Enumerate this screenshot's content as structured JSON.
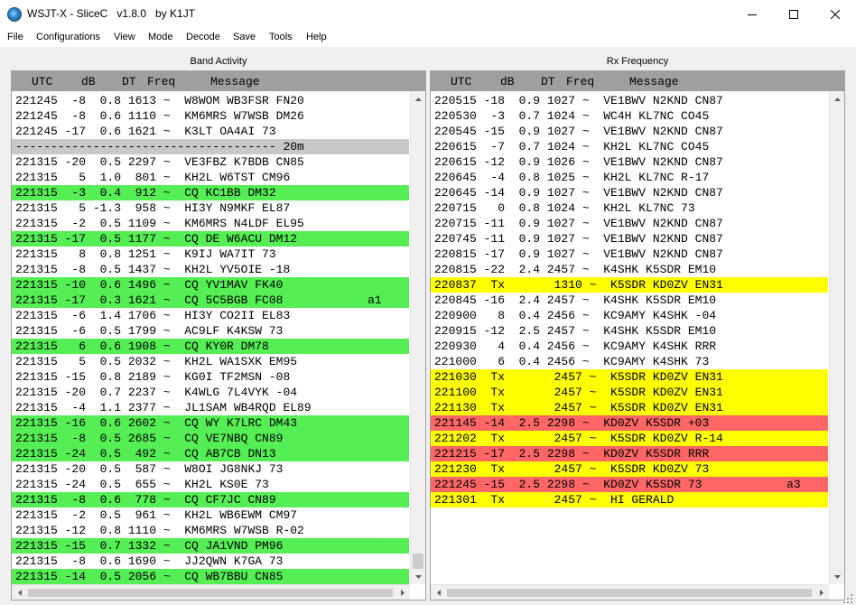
{
  "window": {
    "title": "WSJT-X - SliceC   v1.8.0   by K1JT"
  },
  "menu": [
    "File",
    "Configurations",
    "View",
    "Mode",
    "Decode",
    "Save",
    "Tools",
    "Help"
  ],
  "band_activity": {
    "title": "Band Activity",
    "columns": [
      "UTC",
      "dB",
      "DT",
      "Freq",
      "Message"
    ],
    "rows": [
      {
        "text": "221245  -8  0.8 1613 ~  W8WOM WB3FSR FN20",
        "hl": "none"
      },
      {
        "text": "221245  -8  0.6 1110 ~  KM6MRS W7WSB DM26",
        "hl": "none"
      },
      {
        "text": "221245 -17  0.6 1621 ~  K3LT OA4AI 73",
        "hl": "none"
      },
      {
        "text": "------------------------------------- 20m",
        "hl": "separator"
      },
      {
        "text": "221315 -20  0.5 2297 ~  VE3FBZ K7BDB CN85",
        "hl": "none"
      },
      {
        "text": "221315   5  1.0  801 ~  KH2L W6TST CM96",
        "hl": "none"
      },
      {
        "text": "221315  -3  0.4  912 ~  CQ KC1BB DM32",
        "hl": "cq"
      },
      {
        "text": "221315   5 -1.3  958 ~  HI3Y N9MKF EL87",
        "hl": "none"
      },
      {
        "text": "221315  -2  0.5 1109 ~  KM6MRS N4LDF EL95",
        "hl": "none"
      },
      {
        "text": "221315 -17  0.5 1177 ~  CQ DE W6ACU DM12",
        "hl": "cq"
      },
      {
        "text": "221315   8  0.8 1251 ~  K9IJ WA7IT 73",
        "hl": "none"
      },
      {
        "text": "221315  -8  0.5 1437 ~  KH2L YV5OIE -18",
        "hl": "none"
      },
      {
        "text": "221315 -10  0.6 1496 ~  CQ YV1MAV FK40",
        "hl": "cq"
      },
      {
        "text": "221315 -17  0.3 1621 ~  CQ 5C5BGB FC08            a1",
        "hl": "cq"
      },
      {
        "text": "221315  -6  1.4 1706 ~  HI3Y CO2II EL83",
        "hl": "none"
      },
      {
        "text": "221315  -6  0.5 1799 ~  AC9LF K4KSW 73",
        "hl": "none"
      },
      {
        "text": "221315   6  0.6 1908 ~  CQ KY0R DM78",
        "hl": "cq"
      },
      {
        "text": "221315   5  0.5 2032 ~  KH2L WA1SXK EM95",
        "hl": "none"
      },
      {
        "text": "221315 -15  0.8 2189 ~  KG0I TF2MSN -08",
        "hl": "none"
      },
      {
        "text": "221315 -20  0.7 2237 ~  K4WLG 7L4VYK -04",
        "hl": "none"
      },
      {
        "text": "221315  -4  1.1 2377 ~  JL1SAM WB4RQD EL89",
        "hl": "none"
      },
      {
        "text": "221315 -16  0.6 2602 ~  CQ WY K7LRC DM43",
        "hl": "cq"
      },
      {
        "text": "221315  -8  0.5 2685 ~  CQ VE7NBQ CN89",
        "hl": "cq"
      },
      {
        "text": "221315 -24  0.5  492 ~  CQ AB7CB DN13",
        "hl": "cq"
      },
      {
        "text": "221315 -20  0.5  587 ~  W8OI JG8NKJ 73",
        "hl": "none"
      },
      {
        "text": "221315 -24  0.5  655 ~  KH2L KS0E 73",
        "hl": "none"
      },
      {
        "text": "221315  -8  0.6  778 ~  CQ CF7JC CN89",
        "hl": "cq"
      },
      {
        "text": "221315  -2  0.5  961 ~  KH2L WB6EWM CM97",
        "hl": "none"
      },
      {
        "text": "221315 -12  0.8 1110 ~  KM6MRS W7WSB R-02",
        "hl": "none"
      },
      {
        "text": "221315 -15  0.7 1332 ~  CQ JA1VND PM96",
        "hl": "cq"
      },
      {
        "text": "221315  -8  0.6 1690 ~  JJ2QWN K7GA 73",
        "hl": "none"
      },
      {
        "text": "221315 -14  0.5 2056 ~  CQ WB7BBU CN85",
        "hl": "cq"
      }
    ]
  },
  "rx_frequency": {
    "title": "Rx Frequency",
    "columns": [
      "UTC",
      "dB",
      "DT",
      "Freq",
      "Message"
    ],
    "rows": [
      {
        "text": "220515 -18  0.9 1027 ~  VE1BWV N2KND CN87",
        "hl": "none"
      },
      {
        "text": "220530  -3  0.7 1024 ~  WC4H KL7NC CO45",
        "hl": "none"
      },
      {
        "text": "220545 -15  0.9 1027 ~  VE1BWV N2KND CN87",
        "hl": "none"
      },
      {
        "text": "220615  -7  0.7 1024 ~  KH2L KL7NC CO45",
        "hl": "none"
      },
      {
        "text": "220615 -12  0.9 1026 ~  VE1BWV N2KND CN87",
        "hl": "none"
      },
      {
        "text": "220645  -4  0.8 1025 ~  KH2L KL7NC R-17",
        "hl": "none"
      },
      {
        "text": "220645 -14  0.9 1027 ~  VE1BWV N2KND CN87",
        "hl": "none"
      },
      {
        "text": "220715   0  0.8 1024 ~  KH2L KL7NC 73",
        "hl": "none"
      },
      {
        "text": "220715 -11  0.9 1027 ~  VE1BWV N2KND CN87",
        "hl": "none"
      },
      {
        "text": "220745 -11  0.9 1027 ~  VE1BWV N2KND CN87",
        "hl": "none"
      },
      {
        "text": "220815 -17  0.9 1027 ~  VE1BWV N2KND CN87",
        "hl": "none"
      },
      {
        "text": "220815 -22  2.4 2457 ~  K4SHK K5SDR EM10",
        "hl": "none"
      },
      {
        "text": "220837  Tx       1310 ~  K5SDR KD0ZV EN31",
        "hl": "tx"
      },
      {
        "text": "220845 -16  2.4 2457 ~  K4SHK K5SDR EM10",
        "hl": "none"
      },
      {
        "text": "220900   8  0.4 2456 ~  KC9AMY K4SHK -04",
        "hl": "none"
      },
      {
        "text": "220915 -12  2.5 2457 ~  K4SHK K5SDR EM10",
        "hl": "none"
      },
      {
        "text": "220930   4  0.4 2456 ~  KC9AMY K4SHK RRR",
        "hl": "none"
      },
      {
        "text": "221000   6  0.4 2456 ~  KC9AMY K4SHK 73",
        "hl": "none"
      },
      {
        "text": "221030  Tx       2457 ~  K5SDR KD0ZV EN31",
        "hl": "tx"
      },
      {
        "text": "221100  Tx       2457 ~  K5SDR KD0ZV EN31",
        "hl": "tx"
      },
      {
        "text": "221130  Tx       2457 ~  K5SDR KD0ZV EN31",
        "hl": "tx"
      },
      {
        "text": "221145 -14  2.5 2298 ~  KD0ZV K5SDR +03",
        "hl": "me"
      },
      {
        "text": "221202  Tx       2457 ~  K5SDR KD0ZV R-14",
        "hl": "tx"
      },
      {
        "text": "221215 -17  2.5 2298 ~  KD0ZV K5SDR RRR",
        "hl": "me"
      },
      {
        "text": "221230  Tx       2457 ~  K5SDR KD0ZV 73",
        "hl": "tx"
      },
      {
        "text": "221245 -15  2.5 2298 ~  KD0ZV K5SDR 73            a3",
        "hl": "me"
      },
      {
        "text": "221301  Tx       2457 ~  HI GERALD",
        "hl": "tx"
      }
    ]
  },
  "colors": {
    "cq": "#55ee55",
    "tx": "#ffff00",
    "me": "#ff6666",
    "separator": "#c8c8c8",
    "header": "#9f9f9f"
  },
  "icons": {
    "app": "globe-icon",
    "minimize": "minimize-icon",
    "maximize": "maximize-icon",
    "close": "close-icon"
  }
}
